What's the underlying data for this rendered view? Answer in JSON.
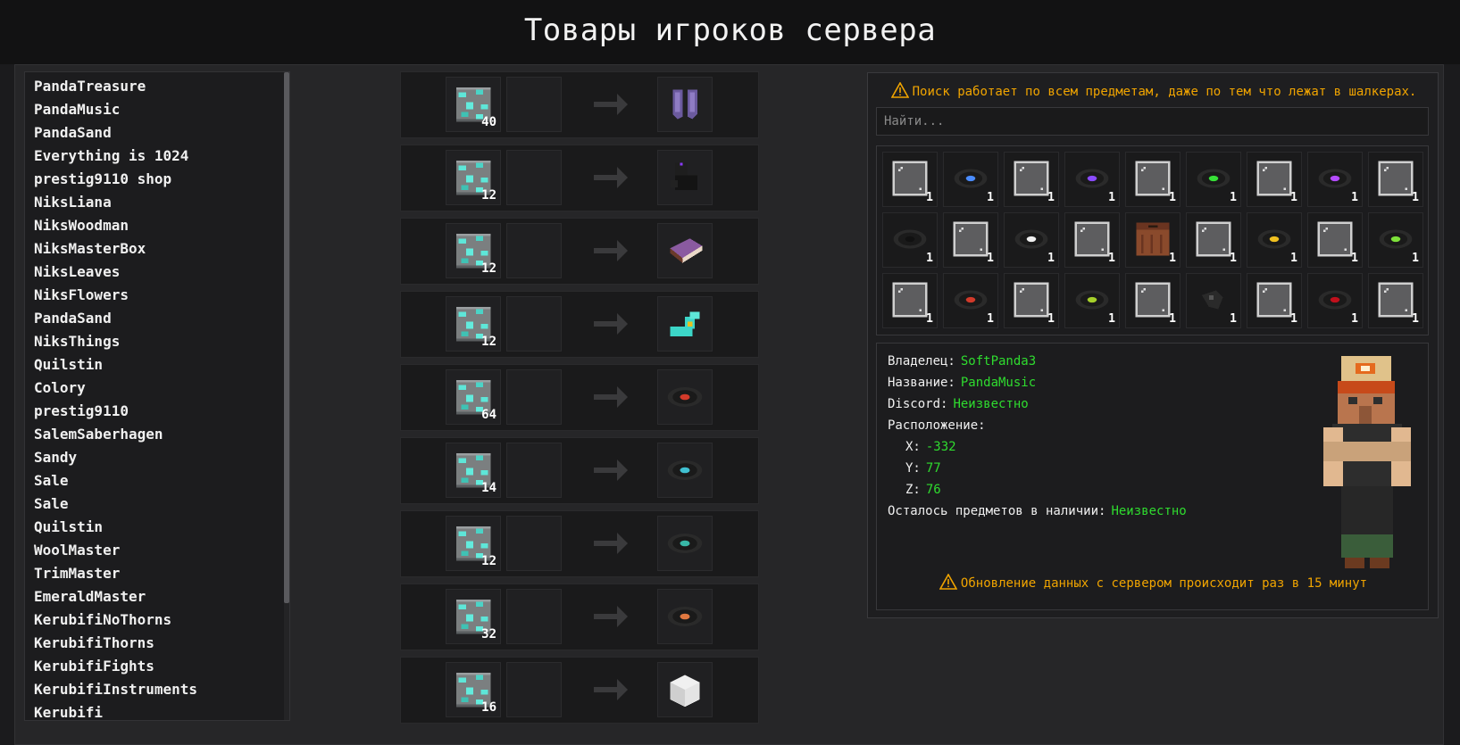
{
  "page": {
    "title": "Товары игроков сервера"
  },
  "players": [
    "PandaTreasure",
    "PandaMusic",
    "PandaSand",
    "Everything is 1024",
    "prestig9110 shop",
    "NiksLiana",
    "NiksWoodman",
    "NiksMasterBox",
    "NiksLeaves",
    "NiksFlowers",
    "PandaSand",
    "NiksThings",
    "Quilstin",
    "Colory",
    "prestig9110",
    "SalemSaberhagen",
    "Sandy",
    "Sale",
    "Sale",
    "Quilstin",
    "WoolMaster",
    "TrimMaster",
    "EmeraldMaster",
    "KerubifiNoThorns",
    "KerubifiThorns",
    "KerubifiFights",
    "KerubifiInstruments",
    "Kerubifi"
  ],
  "trades": [
    {
      "cost_item": "diamond-ore-icon",
      "cost_count": "40",
      "result_item": "elytra-icon"
    },
    {
      "cost_item": "diamond-ore-icon",
      "cost_count": "12",
      "result_item": "horse-head-icon"
    },
    {
      "cost_item": "diamond-ore-icon",
      "cost_count": "12",
      "result_item": "enchanted-book-icon"
    },
    {
      "cost_item": "diamond-ore-icon",
      "cost_count": "12",
      "result_item": "diamond-horse-armor-icon"
    },
    {
      "cost_item": "diamond-ore-icon",
      "cost_count": "64",
      "result_item": "music-disc-red-icon"
    },
    {
      "cost_item": "diamond-ore-icon",
      "cost_count": "14",
      "result_item": "music-disc-cyan-icon"
    },
    {
      "cost_item": "diamond-ore-icon",
      "cost_count": "12",
      "result_item": "music-disc-teal-icon"
    },
    {
      "cost_item": "diamond-ore-icon",
      "cost_count": "32",
      "result_item": "music-disc-orange-icon"
    },
    {
      "cost_item": "diamond-ore-icon",
      "cost_count": "16",
      "result_item": "white-block-icon"
    }
  ],
  "panel": {
    "search_warning": "Поиск работает по всем предметам, даже по тем что лежат в шалкерах.",
    "search_placeholder": "Найти...",
    "grid_items": [
      {
        "icon": "glass-pane-icon",
        "count": "1"
      },
      {
        "icon": "music-disc-blue-icon",
        "count": "1"
      },
      {
        "icon": "glass-pane-icon",
        "count": "1"
      },
      {
        "icon": "music-disc-purple-icon",
        "count": "1"
      },
      {
        "icon": "glass-pane-icon",
        "count": "1"
      },
      {
        "icon": "music-disc-green-icon",
        "count": "1"
      },
      {
        "icon": "glass-pane-icon",
        "count": "1"
      },
      {
        "icon": "music-disc-violet-icon",
        "count": "1"
      },
      {
        "icon": "glass-pane-icon",
        "count": "1"
      },
      {
        "icon": "music-disc-black-icon",
        "count": "1"
      },
      {
        "icon": "glass-pane-icon",
        "count": "1"
      },
      {
        "icon": "music-disc-white-icon",
        "count": "1"
      },
      {
        "icon": "glass-pane-icon",
        "count": "1"
      },
      {
        "icon": "jukebox-icon",
        "count": "1"
      },
      {
        "icon": "glass-pane-icon",
        "count": "1"
      },
      {
        "icon": "music-disc-yellow-icon",
        "count": "1"
      },
      {
        "icon": "glass-pane-icon",
        "count": "1"
      },
      {
        "icon": "music-disc-lime-icon",
        "count": "1"
      },
      {
        "icon": "glass-pane-icon",
        "count": "1"
      },
      {
        "icon": "music-disc-red-icon",
        "count": "1"
      },
      {
        "icon": "glass-pane-icon",
        "count": "1"
      },
      {
        "icon": "music-disc-greenyellow-icon",
        "count": "1"
      },
      {
        "icon": "glass-pane-icon",
        "count": "1"
      },
      {
        "icon": "disc-fragment-icon",
        "count": "1"
      },
      {
        "icon": "glass-pane-icon",
        "count": "1"
      },
      {
        "icon": "music-disc-crimson-icon",
        "count": "1"
      },
      {
        "icon": "glass-pane-icon",
        "count": "1"
      }
    ],
    "info": {
      "owner_label": "Владелец:",
      "owner": "SoftPanda3",
      "name_label": "Название:",
      "name": "PandaMusic",
      "discord_label": "Discord:",
      "discord": "Неизвестно",
      "location_label": "Расположение:",
      "x_label": "X:",
      "x": "-332",
      "y_label": "Y:",
      "y": "77",
      "z_label": "Z:",
      "z": "76",
      "stock_label": "Осталось предметов в наличии:",
      "stock": "Неизвестно",
      "update_warning": "Обновление данных с сервером происходит раз в 15 минут"
    }
  },
  "colors": {
    "accent_green": "#2fdc2f",
    "warning_orange": "#f0a400"
  }
}
